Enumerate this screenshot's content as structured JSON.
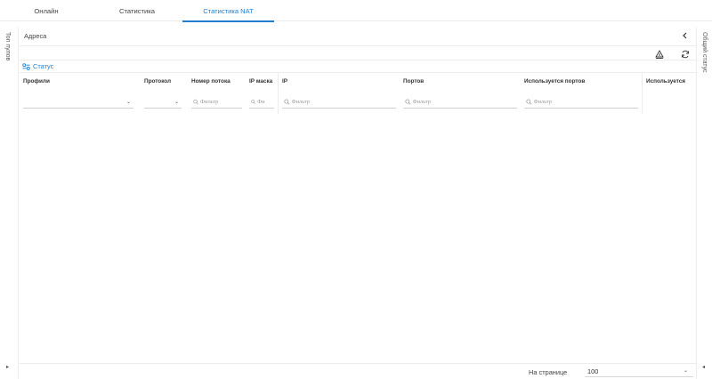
{
  "tabs": [
    {
      "label": "Онлайн"
    },
    {
      "label": "Статистика"
    },
    {
      "label": "Статистика NAT",
      "active": true
    }
  ],
  "left_rail": {
    "label": "Топ пулов",
    "arrow": "▸"
  },
  "right_rail": {
    "label": "Общий статус",
    "arrow": "◂"
  },
  "panel": {
    "title": "Адреса",
    "collapse_icon": "chevron-left-icon",
    "status_link": "Статус"
  },
  "toolbar": {
    "icons": [
      "export-icon",
      "refresh-icon"
    ]
  },
  "columns": [
    {
      "title": "Профили",
      "control": "select"
    },
    {
      "title": "Протокол",
      "control": "select"
    },
    {
      "title": "Номер потока",
      "control": "filter",
      "placeholder": "Фильтр"
    },
    {
      "title": "IP маска",
      "control": "filter",
      "placeholder": "Фи"
    },
    {
      "title": "IP",
      "control": "filter",
      "placeholder": "Фильтр"
    },
    {
      "title": "Портов",
      "control": "filter",
      "placeholder": "Фильтр"
    },
    {
      "title": "Используется портов",
      "control": "filter",
      "placeholder": "Фильтр"
    },
    {
      "title": "Используется",
      "control": "none"
    }
  ],
  "footer": {
    "per_page_label": "На странице",
    "per_page_value": "100"
  },
  "colors": {
    "accent": "#1e7fd0",
    "border": "#ececec"
  }
}
